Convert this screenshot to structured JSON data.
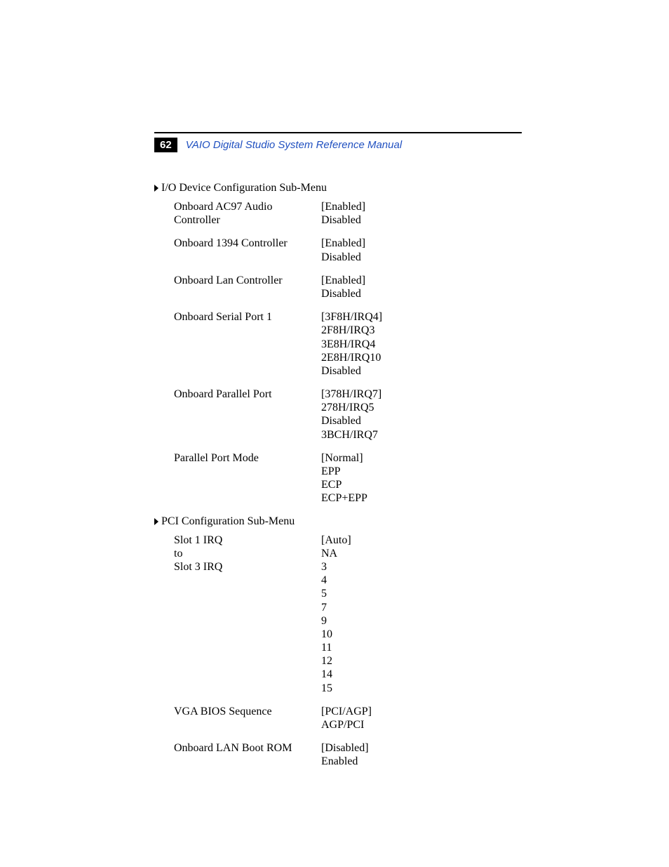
{
  "header": {
    "page_number": "62",
    "title": "VAIO Digital Studio System Reference Manual"
  },
  "sections": {
    "io": {
      "title": "I/O Device Configuration Sub-Menu",
      "entries": {
        "ac97": {
          "label": "Onboard AC97 Audio Controller",
          "v0": "[Enabled]",
          "v1": "Disabled"
        },
        "c1394": {
          "label": "Onboard 1394 Controller",
          "v0": "[Enabled]",
          "v1": "Disabled"
        },
        "lan": {
          "label": "Onboard Lan Controller",
          "v0": "[Enabled]",
          "v1": "Disabled"
        },
        "serial": {
          "label": "Onboard Serial Port 1",
          "v0": "[3F8H/IRQ4]",
          "v1": "2F8H/IRQ3",
          "v2": "3E8H/IRQ4",
          "v3": "2E8H/IRQ10",
          "v4": "Disabled"
        },
        "parallel": {
          "label": "Onboard Parallel Port",
          "v0": "[378H/IRQ7]",
          "v1": "278H/IRQ5",
          "v2": "Disabled",
          "v3": "3BCH/IRQ7"
        },
        "pmode": {
          "label": "Parallel Port Mode",
          "v0": "[Normal]",
          "v1": "EPP",
          "v2": "ECP",
          "v3": "ECP+EPP"
        }
      }
    },
    "pci": {
      "title": " PCI Configuration Sub-Menu",
      "entries": {
        "slots": {
          "l0": "Slot 1 IRQ",
          "l1": "to",
          "l2": "Slot 3 IRQ",
          "v0": "[Auto]",
          "v1": "NA",
          "v2": "3",
          "v3": "4",
          "v4": "5",
          "v5": "7",
          "v6": "9",
          "v7": "10",
          "v8": "11",
          "v9": "12",
          "v10": "14",
          "v11": "15"
        },
        "vga": {
          "label": "VGA BIOS Sequence",
          "v0": "[PCI/AGP]",
          "v1": "AGP/PCI"
        },
        "bootrom": {
          "label": "Onboard LAN Boot ROM",
          "v0": "[Disabled]",
          "v1": "Enabled"
        }
      }
    }
  }
}
